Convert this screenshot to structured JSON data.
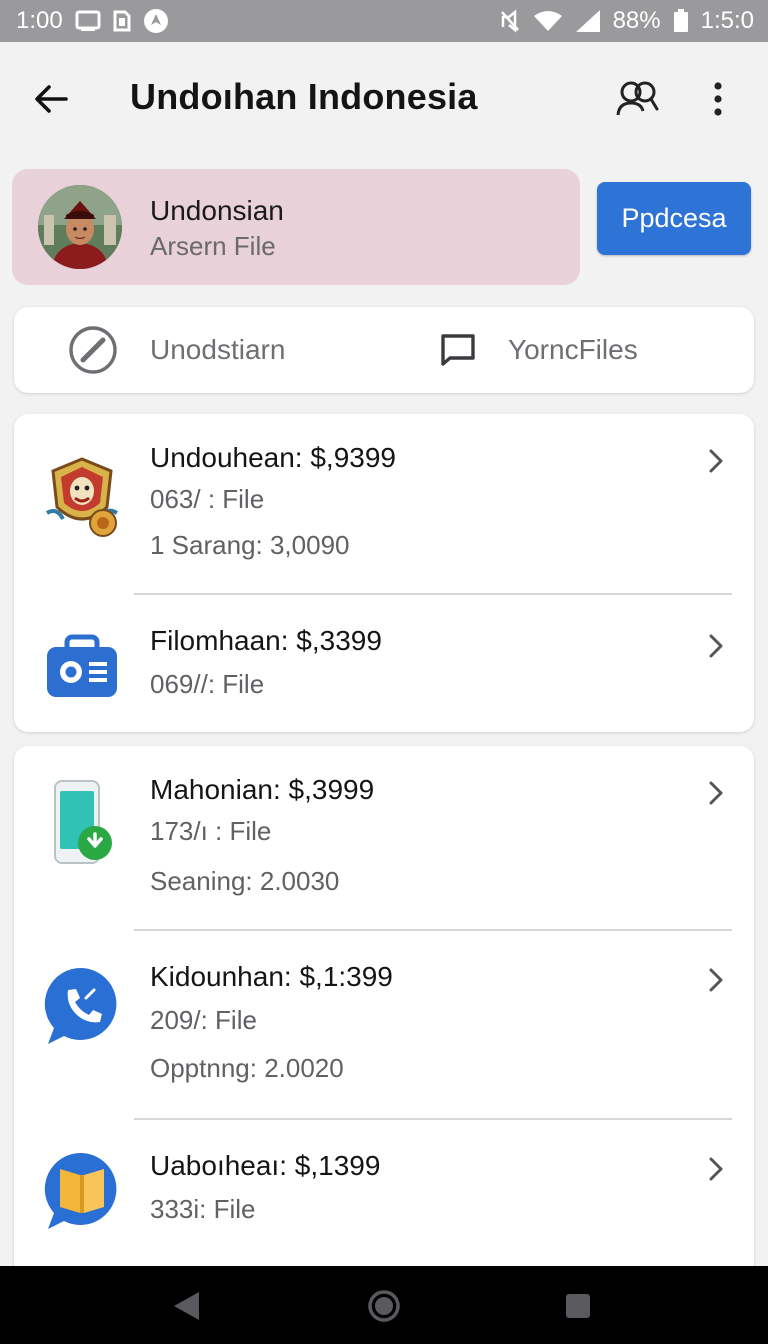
{
  "status_bar": {
    "time_left": "1:00",
    "battery": "88%",
    "time_right": "1:5:0",
    "icons": [
      "screen-icon",
      "sim-icon",
      "location-icon",
      "mute-icon",
      "wifi-icon",
      "signal-icon",
      "battery-icon"
    ]
  },
  "header": {
    "title": "Undoıhan Indonesia",
    "icons": [
      "back-arrow-icon",
      "people-search-icon",
      "more-vertical-icon"
    ]
  },
  "profile": {
    "name": "Undonsian",
    "subtitle": "Arsern File",
    "button_label": "Ppdcesa",
    "banner_color": "#e8d1d9",
    "button_color": "#2e73d6"
  },
  "tabs": [
    {
      "label": "Unodstiarn",
      "icon": "edit-circle-icon"
    },
    {
      "label": "YorncFiles",
      "icon": "chat-bubble-icon"
    }
  ],
  "list": {
    "groups": [
      {
        "items": [
          {
            "title": "Undouhean: $,9399",
            "line1": "063/ : File",
            "line2": "1 Sarang: 3,0090",
            "icon": "mask-emblem-icon"
          },
          {
            "title": "Filomhaan: $,3399",
            "line1": "069//: File",
            "icon": "briefcase-camera-icon"
          }
        ]
      },
      {
        "items": [
          {
            "title": "Mahonian: $,3999",
            "line1": "173/ı : File",
            "line2": "Seaning: 2.0030",
            "icon": "phone-download-icon"
          },
          {
            "title": "Kidounhan: $,1:399",
            "line1": "209/: File",
            "line2": "Opptnng: 2.0020",
            "icon": "phone-chat-icon"
          },
          {
            "title": "Uaboıheaı: $,1399",
            "line1": "333i: File",
            "icon": "book-icon"
          }
        ]
      }
    ]
  },
  "nav": {
    "icons": [
      "nav-back-icon",
      "nav-home-icon",
      "nav-recents-icon"
    ]
  }
}
